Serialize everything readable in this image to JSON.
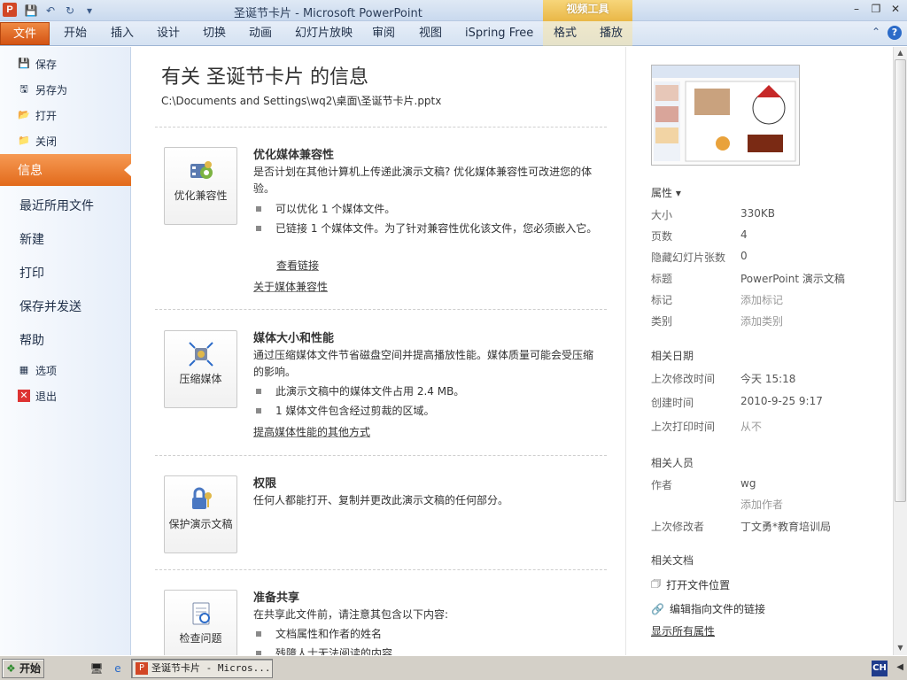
{
  "titlebar": {
    "app_icon": "P",
    "window_title": "圣诞节卡片 - Microsoft PowerPoint",
    "context_tab_header": "视频工具",
    "qat_icons": [
      "save-icon",
      "undo-icon",
      "redo-icon",
      "customize-icon"
    ]
  },
  "ribbon": {
    "file_tab": "文件",
    "tabs": [
      "开始",
      "插入",
      "设计",
      "切换",
      "动画",
      "幻灯片放映",
      "审阅",
      "视图",
      "iSpring Free",
      "格式",
      "播放"
    ]
  },
  "left_nav": {
    "small_top": [
      "保存",
      "另存为",
      "打开",
      "关闭"
    ],
    "active": "信息",
    "big": [
      "最近所用文件",
      "新建",
      "打印",
      "保存并发送",
      "帮助"
    ],
    "small_bottom": [
      "选项",
      "退出"
    ]
  },
  "main": {
    "title": "有关 圣诞节卡片 的信息",
    "path": "C:\\Documents and Settings\\wq2\\桌面\\圣诞节卡片.pptx",
    "sections": [
      {
        "button_label": "优化兼容性",
        "title": "优化媒体兼容性",
        "desc": "是否计划在其他计算机上传递此演示文稿? 优化媒体兼容性可改进您的体验。",
        "bullets": [
          "可以优化 1 个媒体文件。",
          "已链接 1 个媒体文件。为了针对兼容性优化该文件，您必须嵌入它。"
        ],
        "sublink": "查看链接",
        "link": "关于媒体兼容性"
      },
      {
        "button_label": "压缩媒体",
        "title": "媒体大小和性能",
        "desc": "通过压缩媒体文件节省磁盘空间并提高播放性能。媒体质量可能会受压缩的影响。",
        "bullets": [
          "此演示文稿中的媒体文件占用 2.4 MB。",
          "1 媒体文件包含经过剪裁的区域。"
        ],
        "link": "提高媒体性能的其他方式"
      },
      {
        "button_label": "保护演示文稿",
        "title": "权限",
        "desc": "任何人都能打开、复制并更改此演示文稿的任何部分。"
      },
      {
        "button_label": "检查问题",
        "title": "准备共享",
        "desc": "在共享此文件前，请注意其包含以下内容:",
        "bullets": [
          "文档属性和作者的姓名",
          "残障人士无法阅读的内容"
        ]
      }
    ]
  },
  "properties": {
    "header": "属性",
    "rows": [
      {
        "label": "大小",
        "value": "330KB"
      },
      {
        "label": "页数",
        "value": "4"
      },
      {
        "label": "隐藏幻灯片张数",
        "value": "0"
      },
      {
        "label": "标题",
        "value": "PowerPoint 演示文稿"
      },
      {
        "label": "标记",
        "value": "添加标记"
      },
      {
        "label": "类别",
        "value": "添加类别"
      }
    ],
    "dates_header": "相关日期",
    "dates": [
      {
        "label": "上次修改时间",
        "value": "今天 15:18"
      },
      {
        "label": "创建时间",
        "value": "2010-9-25 9:17"
      },
      {
        "label": "上次打印时间",
        "value": "从不"
      }
    ],
    "people_header": "相关人员",
    "author_label": "作者",
    "author_value": "wg",
    "add_author": "添加作者",
    "last_modified_by_label": "上次修改者",
    "last_modified_by_value": "丁文勇*教育培训局",
    "docs_header": "相关文档",
    "open_location": "打开文件位置",
    "edit_links": "编辑指向文件的链接",
    "show_all": "显示所有属性"
  },
  "taskbar": {
    "start": "开始",
    "task_item": "圣诞节卡片 - Micros...",
    "ime": "CH"
  }
}
